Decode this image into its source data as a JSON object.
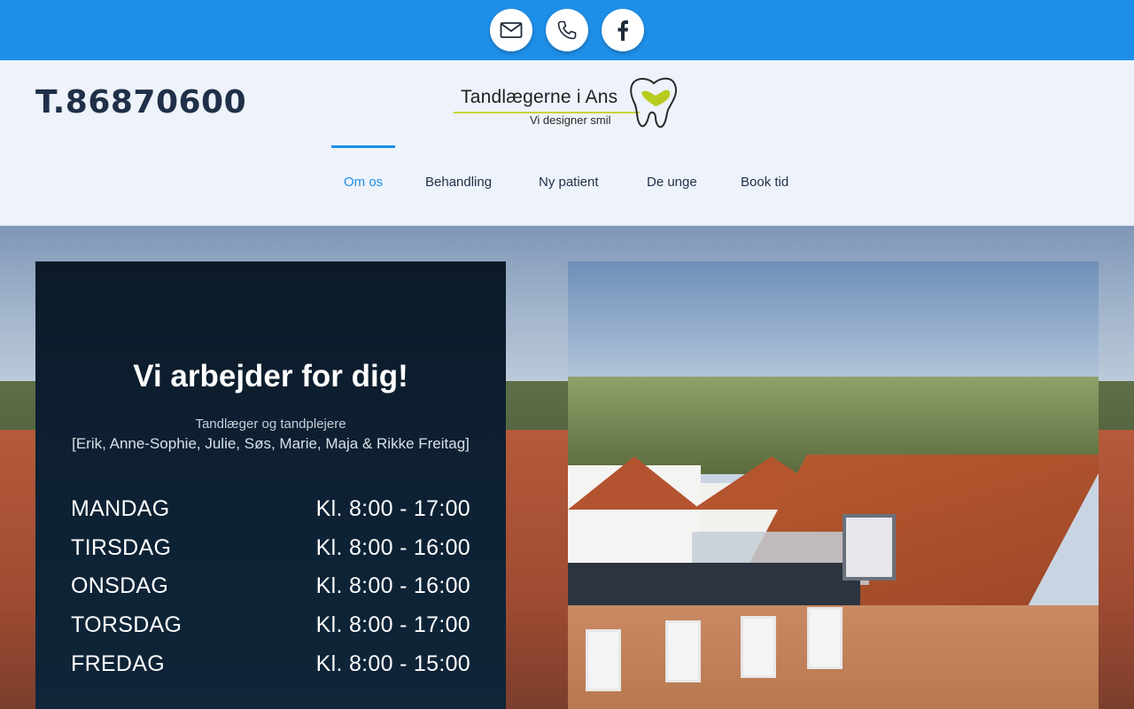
{
  "topbar": {
    "social": [
      {
        "name": "email",
        "icon": "mail-icon"
      },
      {
        "name": "phone",
        "icon": "phone-icon"
      },
      {
        "name": "facebook",
        "icon": "facebook-icon"
      }
    ],
    "color": "#1e8fe9"
  },
  "header": {
    "phone": "T.86870600",
    "logo": {
      "name": "Tandlægerne i Ans",
      "tagline": "Vi designer smil"
    }
  },
  "nav": {
    "items": [
      {
        "label": "Om os",
        "active": true
      },
      {
        "label": "Behandling",
        "active": false
      },
      {
        "label": "Ny patient",
        "active": false
      },
      {
        "label": "De unge",
        "active": false
      },
      {
        "label": "Book tid",
        "active": false
      }
    ],
    "active_color": "#1e8fe9"
  },
  "info": {
    "title": "Vi arbejder for dig!",
    "subtitle": "Tandlæger og tandplejere",
    "names": "[Erik, Anne-Sophie, Julie, Søs, Marie, Maja & Rikke Freitag]",
    "hours": [
      {
        "day": "MANDAG",
        "time": "Kl. 8:00 - 17:00"
      },
      {
        "day": "TIRSDAG",
        "time": "Kl. 8:00 - 16:00"
      },
      {
        "day": "ONSDAG",
        "time": "Kl. 8:00 - 16:00"
      },
      {
        "day": "TORSDAG",
        "time": "Kl. 8:00 - 17:00"
      },
      {
        "day": "FREDAG",
        "time": "Kl. 8:00 - 15:00"
      }
    ]
  }
}
